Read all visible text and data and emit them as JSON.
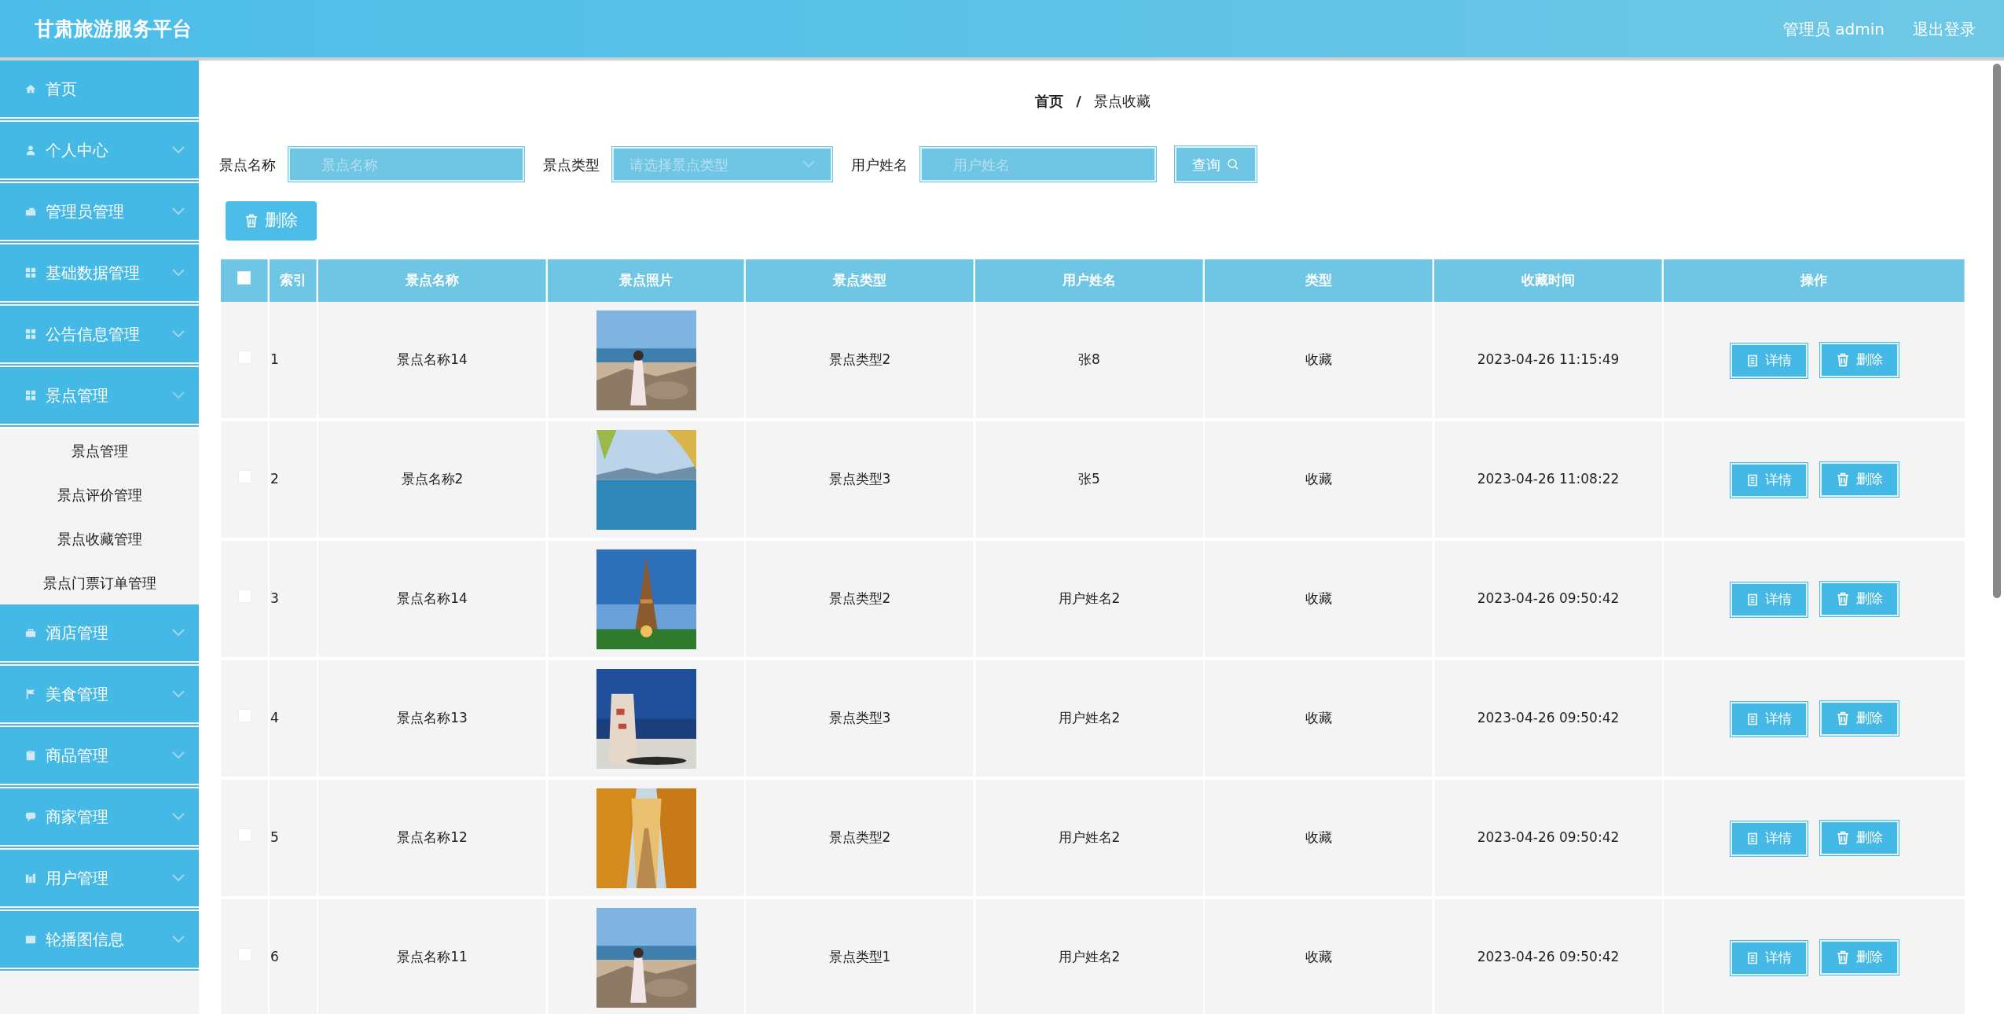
{
  "header": {
    "title": "甘肃旅游服务平台",
    "user": "管理员 admin",
    "logout": "退出登录"
  },
  "sidebar": {
    "items": [
      {
        "label": "首页",
        "kind": "link"
      },
      {
        "label": "个人中心",
        "kind": "menu",
        "expanded": false
      },
      {
        "label": "管理员管理",
        "kind": "menu",
        "expanded": false
      },
      {
        "label": "基础数据管理",
        "kind": "menu",
        "expanded": false
      },
      {
        "label": "公告信息管理",
        "kind": "menu",
        "expanded": false
      },
      {
        "label": "景点管理",
        "kind": "menu",
        "expanded": true,
        "children": [
          {
            "label": "景点管理"
          },
          {
            "label": "景点评价管理"
          },
          {
            "label": "景点收藏管理"
          },
          {
            "label": "景点门票订单管理"
          }
        ]
      },
      {
        "label": "酒店管理",
        "kind": "menu",
        "expanded": false
      },
      {
        "label": "美食管理",
        "kind": "menu",
        "expanded": false
      },
      {
        "label": "商品管理",
        "kind": "menu",
        "expanded": false
      },
      {
        "label": "商家管理",
        "kind": "menu",
        "expanded": false
      },
      {
        "label": "用户管理",
        "kind": "menu",
        "expanded": false
      },
      {
        "label": "轮播图信息",
        "kind": "menu",
        "expanded": false
      }
    ]
  },
  "breadcrumb": {
    "home": "首页",
    "separator": "/",
    "current": "景点收藏"
  },
  "filters": [
    {
      "label": "景点名称",
      "kind": "input",
      "placeholder": "景点名称"
    },
    {
      "label": "景点类型",
      "kind": "select",
      "placeholder": "请选择景点类型"
    },
    {
      "label": "用户姓名",
      "kind": "input",
      "placeholder": "用户姓名"
    }
  ],
  "search_button": "查询",
  "delete_button": "删除",
  "table": {
    "header_checked": false,
    "columns": [
      "索引",
      "景点名称",
      "景点照片",
      "景点类型",
      "用户姓名",
      "类型",
      "收藏时间",
      "操作"
    ],
    "rows": [
      {
        "selected": false,
        "index": "1",
        "name": "景点名称14",
        "photo": {
          "kind": "picture"
        },
        "type": "景点类型2",
        "user": "张8",
        "category": "收藏",
        "time": "2023-04-26 11:15:49",
        "actions": [
          "详情",
          "删除"
        ]
      },
      {
        "selected": false,
        "index": "2",
        "name": "景点名称2",
        "photo": {
          "kind": "picture"
        },
        "type": "景点类型3",
        "user": "张5",
        "category": "收藏",
        "time": "2023-04-26 11:08:22",
        "actions": [
          "详情",
          "删除"
        ]
      },
      {
        "selected": false,
        "index": "3",
        "name": "景点名称14",
        "photo": {
          "kind": "picture"
        },
        "type": "景点类型2",
        "user": "用户姓名2",
        "category": "收藏",
        "time": "2023-04-26 09:50:42",
        "actions": [
          "详情",
          "删除"
        ]
      },
      {
        "selected": false,
        "index": "4",
        "name": "景点名称13",
        "photo": {
          "kind": "picture"
        },
        "type": "景点类型3",
        "user": "用户姓名2",
        "category": "收藏",
        "time": "2023-04-26 09:50:42",
        "actions": [
          "详情",
          "删除"
        ]
      },
      {
        "selected": false,
        "index": "5",
        "name": "景点名称12",
        "photo": {
          "kind": "picture"
        },
        "type": "景点类型2",
        "user": "用户姓名2",
        "category": "收藏",
        "time": "2023-04-26 09:50:42",
        "actions": [
          "详情",
          "删除"
        ]
      },
      {
        "selected": false,
        "index": "6",
        "name": "景点名称11",
        "photo": {
          "kind": "picture"
        },
        "type": "景点类型1",
        "user": "用户姓名2",
        "category": "收藏",
        "time": "2023-04-26 09:50:42",
        "actions": [
          "详情",
          "删除"
        ]
      }
    ]
  }
}
